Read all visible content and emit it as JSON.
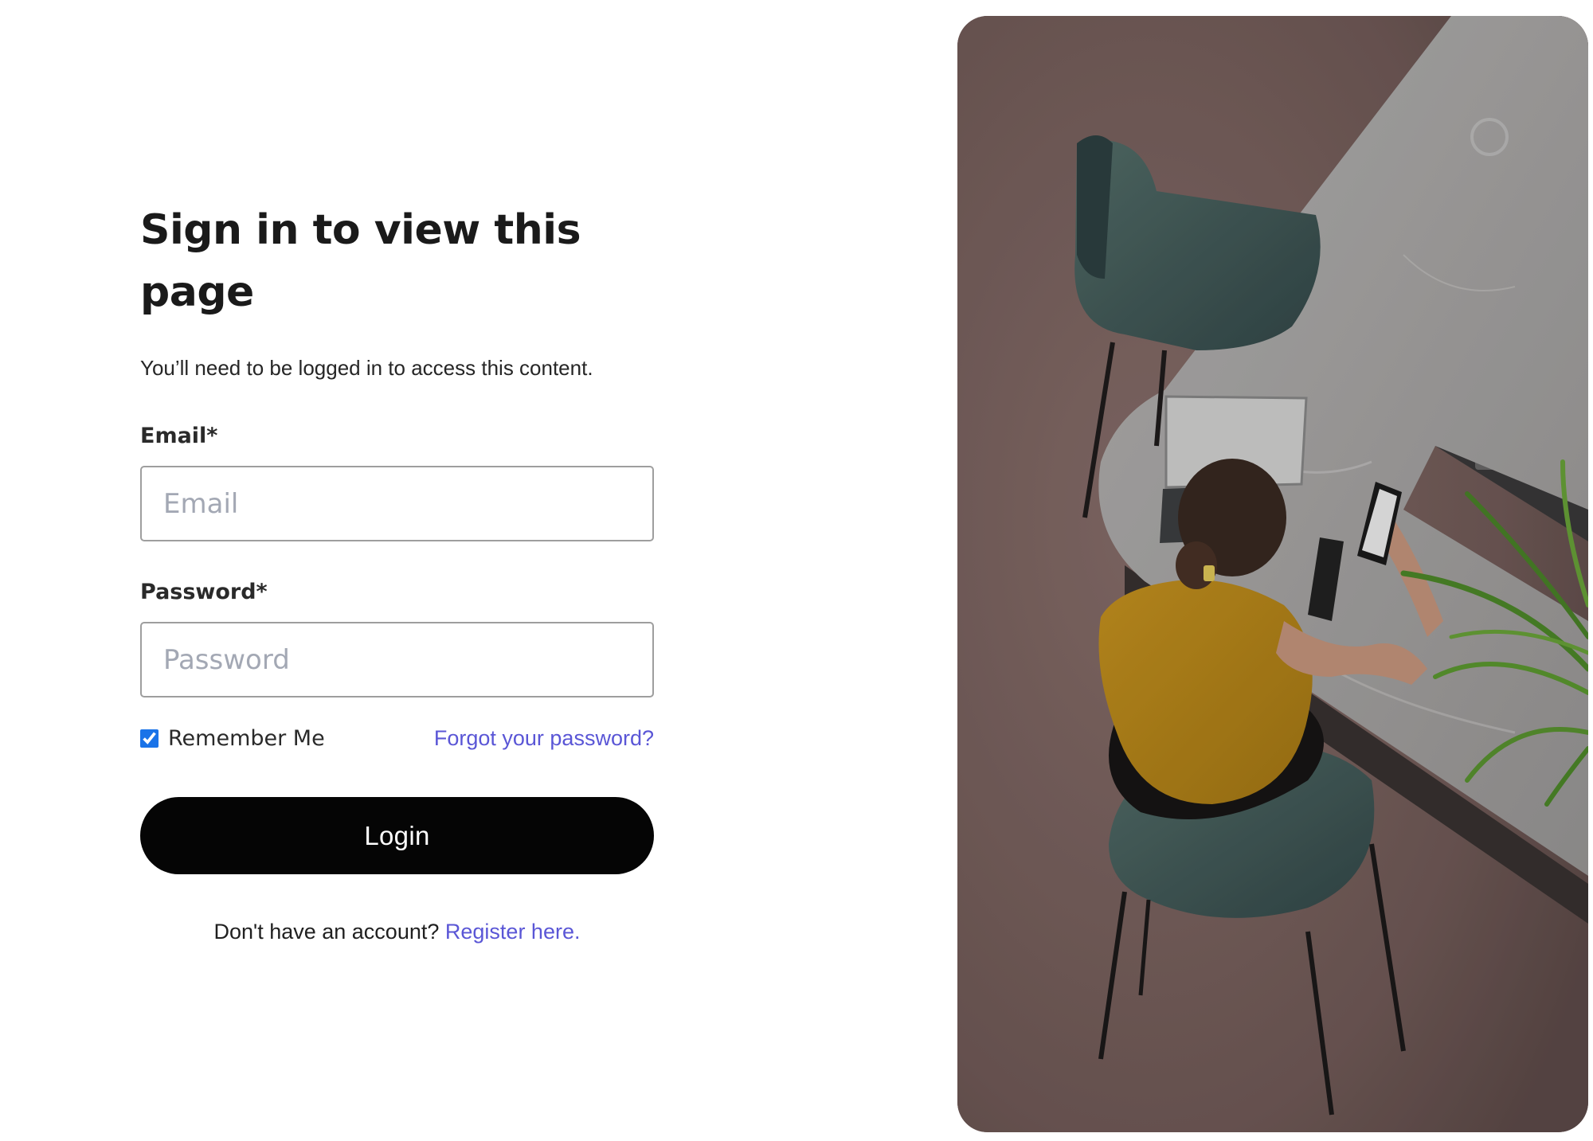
{
  "login": {
    "title": "Sign in to view this page",
    "subtitle": "You’ll need to be logged in to access this content.",
    "email": {
      "label": "Email*",
      "placeholder": "Email",
      "value": ""
    },
    "password": {
      "label": "Password*",
      "placeholder": "Password",
      "value": ""
    },
    "remember_me": {
      "label": "Remember Me",
      "checked": true
    },
    "forgot_password_label": "Forgot your password?",
    "login_button_label": "Login",
    "register_prompt": "Don't have an account?",
    "register_link_label": "Register here."
  },
  "theme": {
    "link_color": "#5a56d6",
    "button_color": "#050505",
    "checkbox_color": "#1a73e8",
    "input_border_color": "#9e9e9e"
  },
  "hero_image": {
    "icons": [
      "woman-at-counter-photo",
      "chair-icon",
      "phone-icon",
      "tablet-icon",
      "plant-icon"
    ]
  }
}
